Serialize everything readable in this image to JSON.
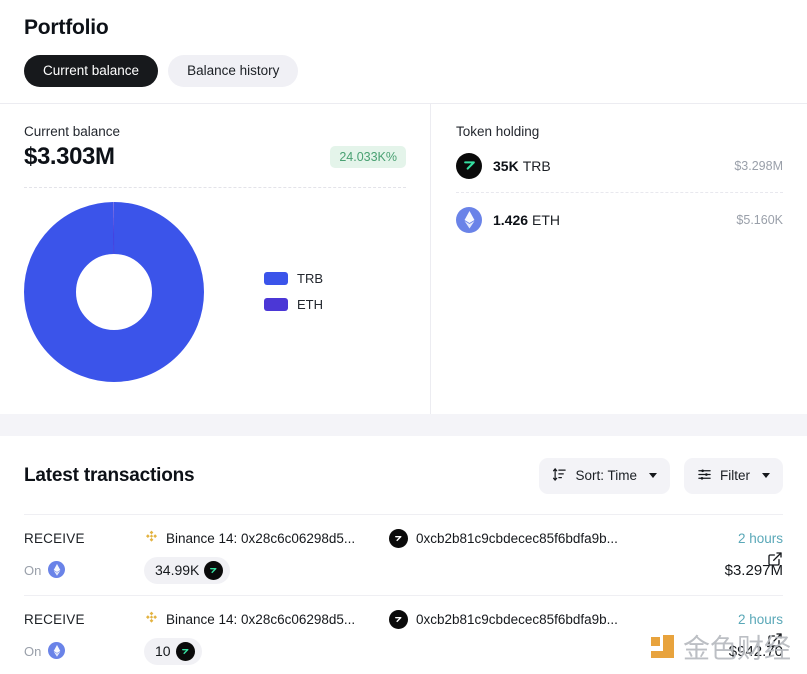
{
  "header": {
    "title": "Portfolio",
    "tabs": [
      {
        "label": "Current balance",
        "active": true
      },
      {
        "label": "Balance history",
        "active": false
      }
    ]
  },
  "balance": {
    "label": "Current balance",
    "amount": "$3.303M",
    "change_badge": "24.033K%",
    "badge_color": "#4aa173",
    "badge_bg": "#e4f4ea"
  },
  "chart_data": {
    "type": "pie",
    "title": "",
    "variant": "donut",
    "categories": [
      "TRB",
      "ETH"
    ],
    "values": [
      3298000,
      5160
    ],
    "percentages": [
      99.84,
      0.16
    ],
    "colors": [
      "#3b54ea",
      "#4b37d6"
    ],
    "legend": [
      "TRB",
      "ETH"
    ],
    "legend_position": "right",
    "value_labels": [
      "$3.298M",
      "$5.160K"
    ]
  },
  "token_holding": {
    "title": "Token holding",
    "rows": [
      {
        "icon": "trb-token-icon",
        "amount": "35K",
        "symbol": "TRB",
        "value": "$3.298M"
      },
      {
        "icon": "eth-token-icon",
        "amount": "1.426",
        "symbol": "ETH",
        "value": "$5.160K"
      }
    ]
  },
  "transactions": {
    "title": "Latest transactions",
    "sort_label": "Sort: Time",
    "filter_label": "Filter",
    "rows": [
      {
        "type": "RECEIVE",
        "on_label": "On",
        "chain_icon": "eth-chain-icon",
        "from_icon": "binance-icon",
        "from": "Binance 14: 0x28c6c06298d5...",
        "to_icon": "trb-token-icon",
        "to": "0xcb2b81c9cbdecec85f6bdfa9b...",
        "amount": "34.99K",
        "amount_icon": "trb-token-icon",
        "time": "2 hours",
        "usd": "$3.297M"
      },
      {
        "type": "RECEIVE",
        "on_label": "On",
        "chain_icon": "eth-chain-icon",
        "from_icon": "binance-icon",
        "from": "Binance 14: 0x28c6c06298d5...",
        "to_icon": "trb-token-icon",
        "to": "0xcb2b81c9cbdecec85f6bdfa9b...",
        "amount": "10",
        "amount_icon": "trb-token-icon",
        "time": "2 hours",
        "usd": "$942.70"
      }
    ]
  },
  "watermark": {
    "text": "金色财经"
  }
}
